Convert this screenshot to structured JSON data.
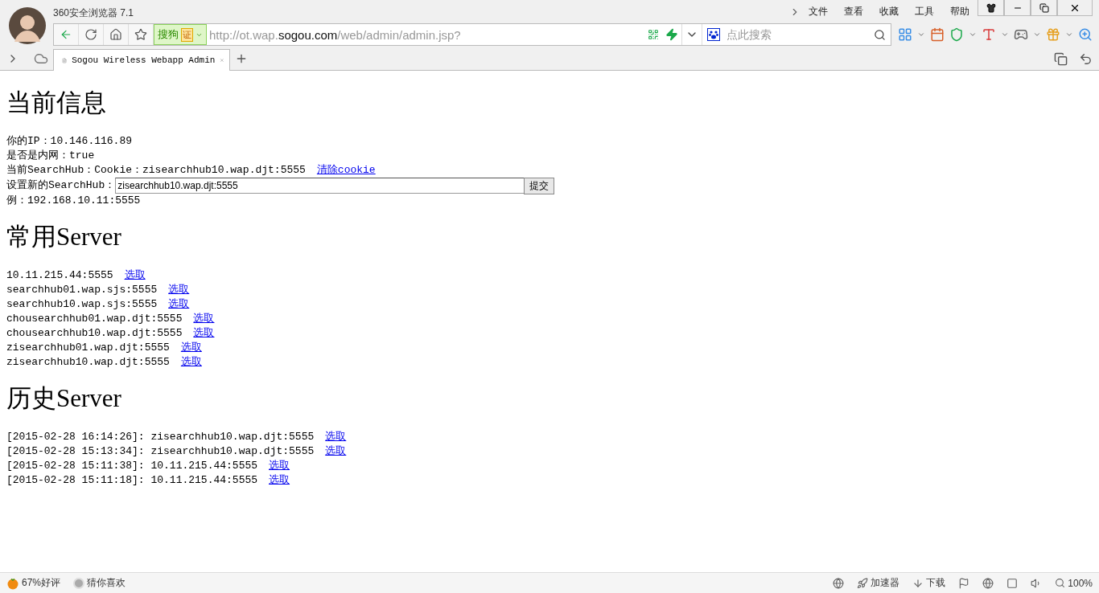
{
  "browser": {
    "title": "360安全浏览器 7.1",
    "menu": [
      "文件",
      "查看",
      "收藏",
      "工具",
      "帮助"
    ],
    "address": {
      "engine": "搜狗",
      "cert": "证",
      "url": "http://ot.wap.**sogou.com**/web/admin/admin.jsp?"
    },
    "search": {
      "placeholder": "点此搜索"
    },
    "tabs": [
      {
        "label": "Sogou Wireless Webapp Admin",
        "selected": true
      }
    ]
  },
  "current_info": {
    "heading": "当前信息",
    "lines": [
      "你的IP：10.146.116.89",
      "是否是内网：true"
    ],
    "cookie": {
      "text": "当前SearchHub：Cookie：zisearchhub10.wap.djt:5555",
      "link": "清除cookie"
    },
    "set_form": {
      "label": "设置新的SearchHub：",
      "value": "zisearchhub10.wap.djt:5555",
      "button": "提交"
    },
    "example": "例：192.168.10.11:5555"
  },
  "common_servers": {
    "heading": "常用Server",
    "items": [
      {
        "text": "10.11.215.44:5555",
        "link": "选取"
      },
      {
        "text": "searchhub01.wap.sjs:5555",
        "link": "选取"
      },
      {
        "text": "searchhub10.wap.sjs:5555",
        "link": "选取"
      },
      {
        "text": "chousearchhub01.wap.djt:5555",
        "link": "选取"
      },
      {
        "text": "chousearchhub10.wap.djt:5555",
        "link": "选取"
      },
      {
        "text": "zisearchhub01.wap.djt:5555",
        "link": "选取"
      },
      {
        "text": "zisearchhub10.wap.djt:5555",
        "link": "选取"
      }
    ]
  },
  "history_servers": {
    "heading": "历史Server",
    "items": [
      {
        "text": "[2015-02-28 16:14:26]: zisearchhub10.wap.djt:5555",
        "link": "选取"
      },
      {
        "text": "[2015-02-28 15:13:34]: zisearchhub10.wap.djt:5555",
        "link": "选取"
      },
      {
        "text": "[2015-02-28 15:11:38]: 10.11.215.44:5555",
        "link": "选取"
      },
      {
        "text": "[2015-02-28 15:11:18]: 10.11.215.44:5555",
        "link": "选取"
      }
    ]
  },
  "status_bar": {
    "rating": "67%好评",
    "recommend": "猜你喜欢",
    "accelerator": "加速器",
    "download": "下载",
    "zoom": "100%"
  }
}
